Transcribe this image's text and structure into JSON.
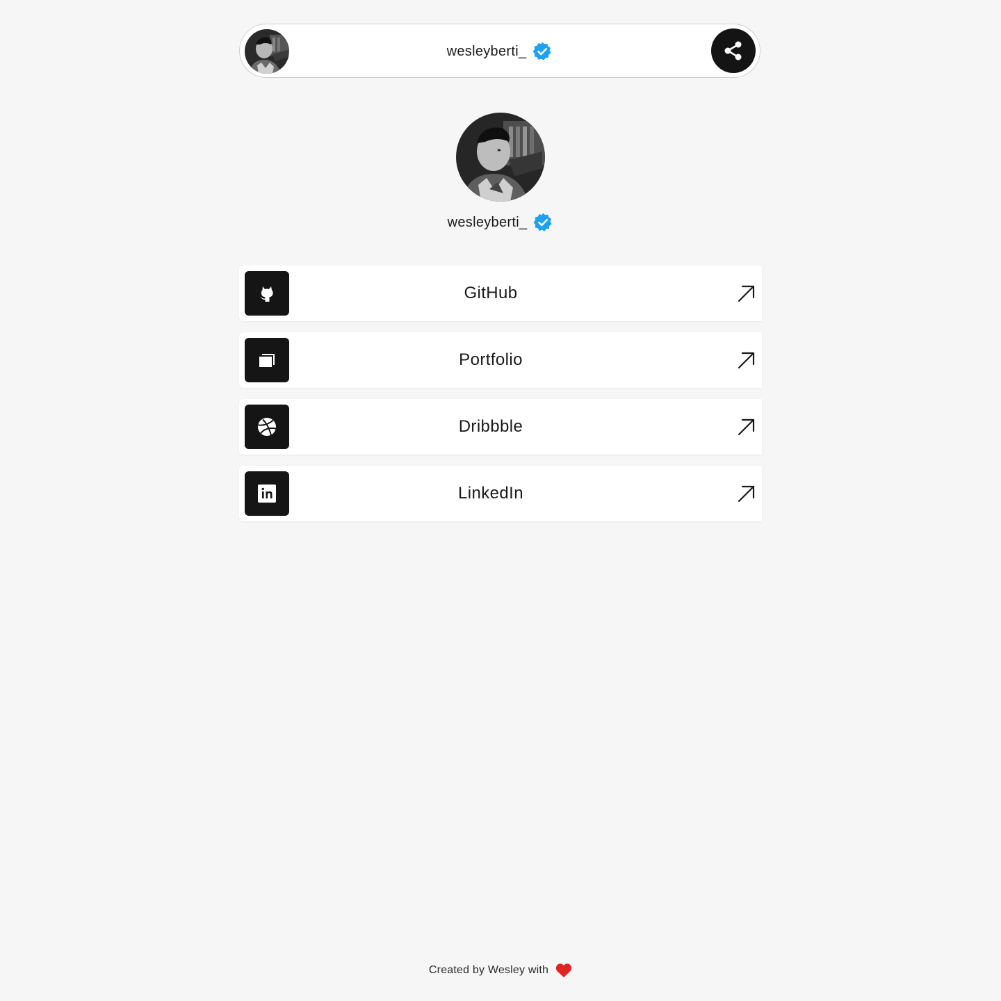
{
  "header": {
    "username": "wesleyberti_",
    "avatar_icon": "profile-photo",
    "verified_icon": "verified-badge-icon",
    "share_icon": "share-icon"
  },
  "profile": {
    "username": "wesleyberti_",
    "avatar_icon": "profile-photo",
    "verified_icon": "verified-badge-icon"
  },
  "links": [
    {
      "label": "GitHub",
      "icon": "github-icon",
      "action_icon": "external-arrow-icon"
    },
    {
      "label": "Portfolio",
      "icon": "portfolio-icon",
      "action_icon": "external-arrow-icon"
    },
    {
      "label": "Dribbble",
      "icon": "dribbble-icon",
      "action_icon": "external-arrow-icon"
    },
    {
      "label": "LinkedIn",
      "icon": "linkedin-icon",
      "action_icon": "external-arrow-icon"
    }
  ],
  "footer": {
    "text": "Created by Wesley with",
    "icon": "heart-icon"
  },
  "colors": {
    "background": "#f6f6f6",
    "card": "#ffffff",
    "icon_tile": "#151515",
    "verified": "#1da1f2",
    "heart": "#e02424"
  }
}
